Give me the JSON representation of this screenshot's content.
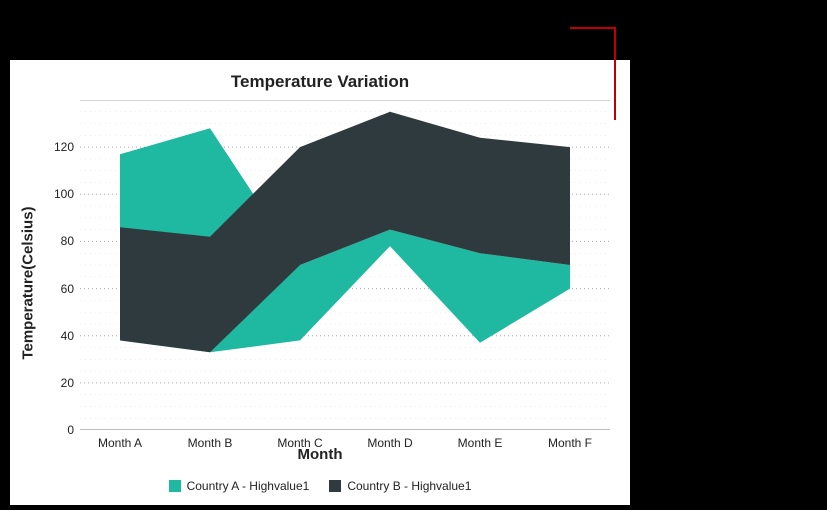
{
  "chart_data": {
    "type": "area",
    "title": "Temperature Variation",
    "xlabel": "Month",
    "ylabel": "Temperature(Celsius)",
    "categories": [
      "Month A",
      "Month B",
      "Month C",
      "Month D",
      "Month E",
      "Month F"
    ],
    "yticks": [
      0,
      20,
      40,
      60,
      80,
      100,
      120
    ],
    "ylim": [
      0,
      140
    ],
    "series": [
      {
        "name": "Country A - Highvalue1",
        "color": "#1fb8a0",
        "high": [
          117,
          128,
          70,
          85,
          75,
          70
        ],
        "low": [
          38,
          33,
          38,
          78,
          37,
          60
        ]
      },
      {
        "name": "Country B - Highvalue1",
        "color": "#2f3a3f",
        "high": [
          86,
          82,
          120,
          135,
          124,
          120
        ],
        "low": [
          38,
          33,
          70,
          85,
          75,
          70
        ]
      }
    ]
  }
}
